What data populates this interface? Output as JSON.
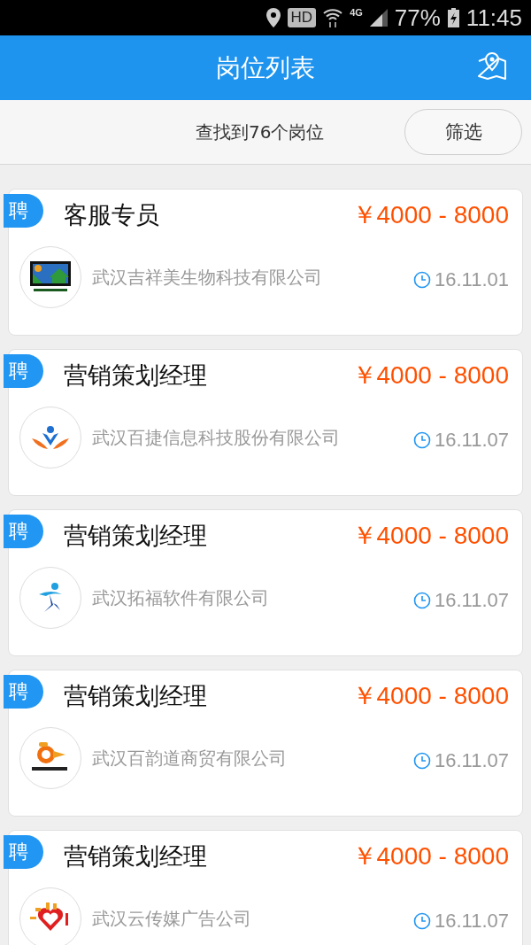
{
  "status_bar": {
    "network": "HD",
    "signal_type": "4G",
    "battery": "77%",
    "time": "11:45"
  },
  "header": {
    "title": "岗位列表"
  },
  "summary": {
    "text": "查找到76个岗位",
    "filter_button": "筛选"
  },
  "jobs": [
    {
      "badge": "聘",
      "title": "客服专员",
      "salary": "￥4000 - 8000",
      "company": "武汉吉祥美生物科技有限公司",
      "date": "16.11.01",
      "logo": {
        "kind": "house"
      }
    },
    {
      "badge": "聘",
      "title": "营销策划经理",
      "salary": "￥4000 - 8000",
      "company": "武汉百捷信息科技股份有限公司",
      "date": "16.11.07",
      "logo": {
        "kind": "people"
      }
    },
    {
      "badge": "聘",
      "title": "营销策划经理",
      "salary": "￥4000 - 8000",
      "company": "武汉拓福软件有限公司",
      "date": "16.11.07",
      "logo": {
        "kind": "runner"
      }
    },
    {
      "badge": "聘",
      "title": "营销策划经理",
      "salary": "￥4000 - 8000",
      "company": "武汉百韵道商贸有限公司",
      "date": "16.11.07",
      "logo": {
        "kind": "swirl"
      }
    },
    {
      "badge": "聘",
      "title": "营销策划经理",
      "salary": "￥4000 - 8000",
      "company": "武汉云传媒广告公司",
      "date": "16.11.07",
      "logo": {
        "kind": "heart"
      }
    }
  ]
}
